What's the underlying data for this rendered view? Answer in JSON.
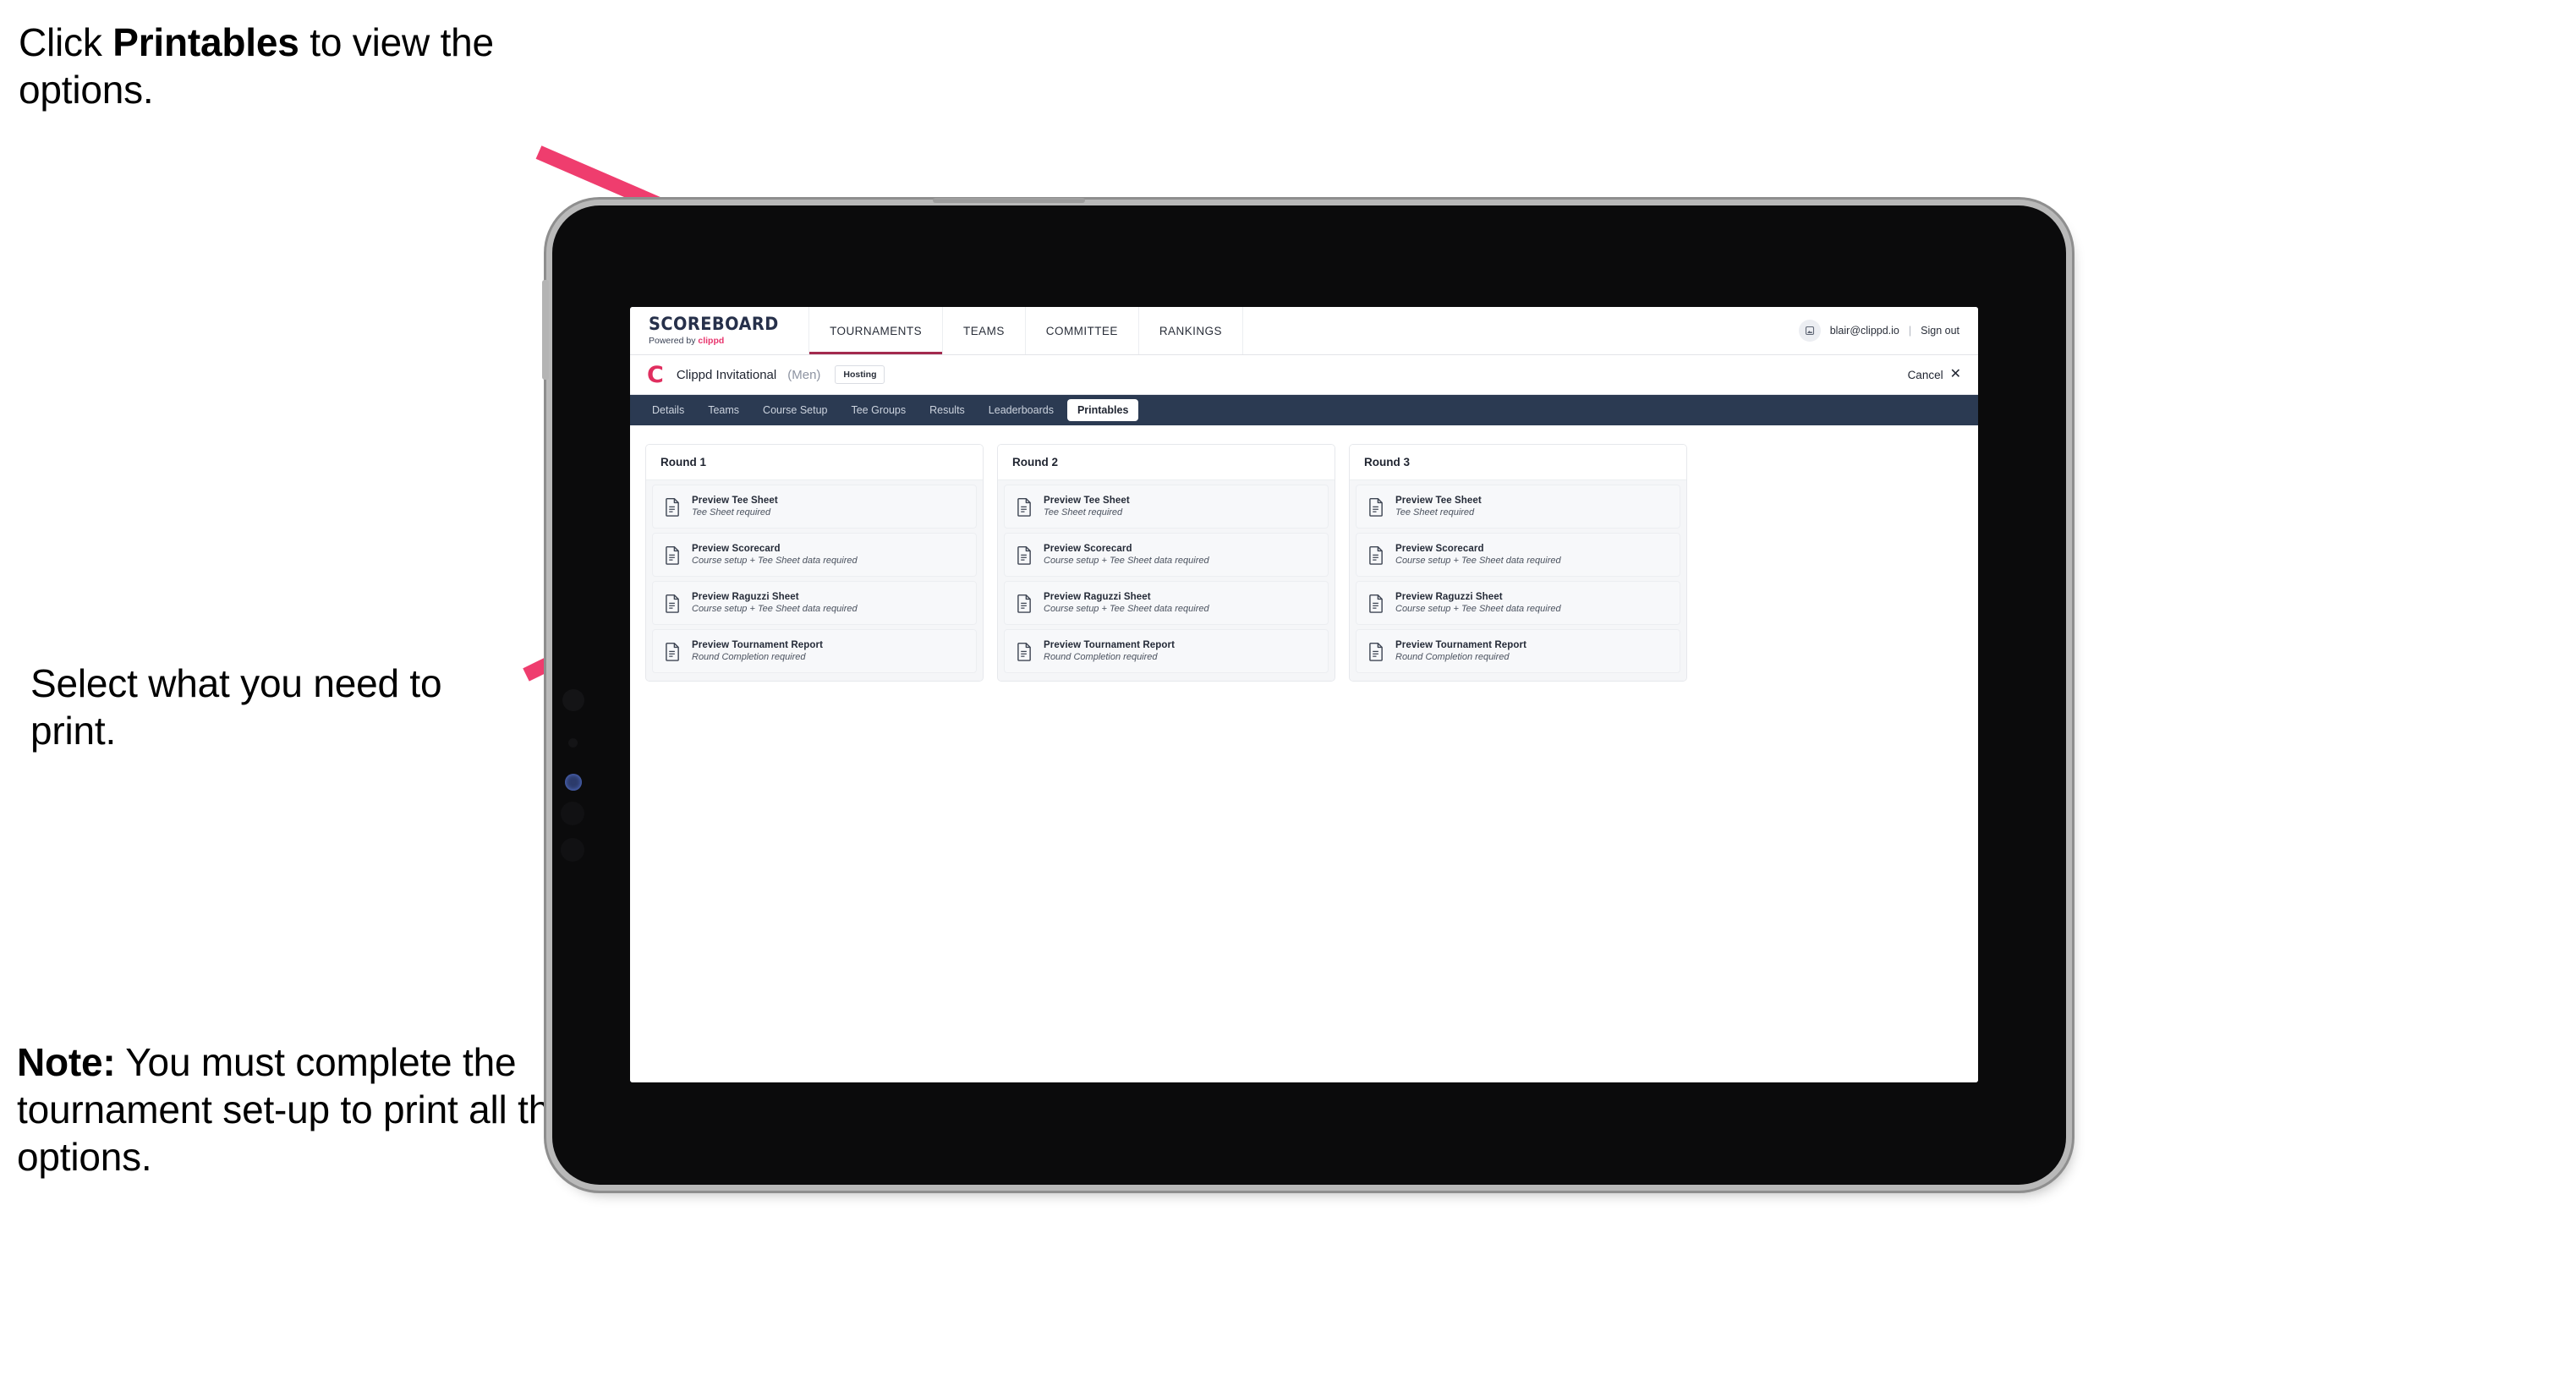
{
  "annotations": {
    "click_printables": {
      "prefix": "Click ",
      "bold": "Printables",
      "suffix": " to view the options."
    },
    "select_print": "Select what you need to print.",
    "note": {
      "bold": "Note:",
      "text": " You must complete the tournament set-up to print all the options."
    }
  },
  "colors": {
    "accent_pink": "#ef3d6e",
    "brand_navy": "#26304a",
    "brand_pink": "#e8356d",
    "tabstrip_navy": "#2b3a52",
    "active_tab_underline": "#a32a4e"
  },
  "app": {
    "brand": {
      "name": "SCOREBOARD",
      "powered_prefix": "Powered by ",
      "powered_brand": "clippd"
    },
    "top_nav": [
      {
        "label": "TOURNAMENTS",
        "active": true
      },
      {
        "label": "TEAMS",
        "active": false
      },
      {
        "label": "COMMITTEE",
        "active": false
      },
      {
        "label": "RANKINGS",
        "active": false
      }
    ],
    "user": {
      "avatar_icon": "user-avatar-icon",
      "email": "blair@clippd.io",
      "separator": "|",
      "sign_out": "Sign out"
    },
    "tournament": {
      "logo_letter": "C",
      "title": "Clippd Invitational",
      "gender": "(Men)",
      "status_chip": "Hosting",
      "cancel_label": "Cancel",
      "cancel_icon": "close-icon"
    },
    "tabs": [
      {
        "label": "Details",
        "active": false
      },
      {
        "label": "Teams",
        "active": false
      },
      {
        "label": "Course Setup",
        "active": false
      },
      {
        "label": "Tee Groups",
        "active": false
      },
      {
        "label": "Results",
        "active": false
      },
      {
        "label": "Leaderboards",
        "active": false
      },
      {
        "label": "Printables",
        "active": true
      }
    ],
    "rounds": [
      {
        "title": "Round 1",
        "items": [
          {
            "title": "Preview Tee Sheet",
            "sub": "Tee Sheet required",
            "icon": "document-icon"
          },
          {
            "title": "Preview Scorecard",
            "sub": "Course setup + Tee Sheet data required",
            "icon": "document-icon"
          },
          {
            "title": "Preview Raguzzi Sheet",
            "sub": "Course setup + Tee Sheet data required",
            "icon": "document-icon"
          },
          {
            "title": "Preview Tournament Report",
            "sub": "Round Completion required",
            "icon": "document-icon"
          }
        ]
      },
      {
        "title": "Round 2",
        "items": [
          {
            "title": "Preview Tee Sheet",
            "sub": "Tee Sheet required",
            "icon": "document-icon"
          },
          {
            "title": "Preview Scorecard",
            "sub": "Course setup + Tee Sheet data required",
            "icon": "document-icon"
          },
          {
            "title": "Preview Raguzzi Sheet",
            "sub": "Course setup + Tee Sheet data required",
            "icon": "document-icon"
          },
          {
            "title": "Preview Tournament Report",
            "sub": "Round Completion required",
            "icon": "document-icon"
          }
        ]
      },
      {
        "title": "Round 3",
        "items": [
          {
            "title": "Preview Tee Sheet",
            "sub": "Tee Sheet required",
            "icon": "document-icon"
          },
          {
            "title": "Preview Scorecard",
            "sub": "Course setup + Tee Sheet data required",
            "icon": "document-icon"
          },
          {
            "title": "Preview Raguzzi Sheet",
            "sub": "Course setup + Tee Sheet data required",
            "icon": "document-icon"
          },
          {
            "title": "Preview Tournament Report",
            "sub": "Round Completion required",
            "icon": "document-icon"
          }
        ]
      }
    ]
  }
}
